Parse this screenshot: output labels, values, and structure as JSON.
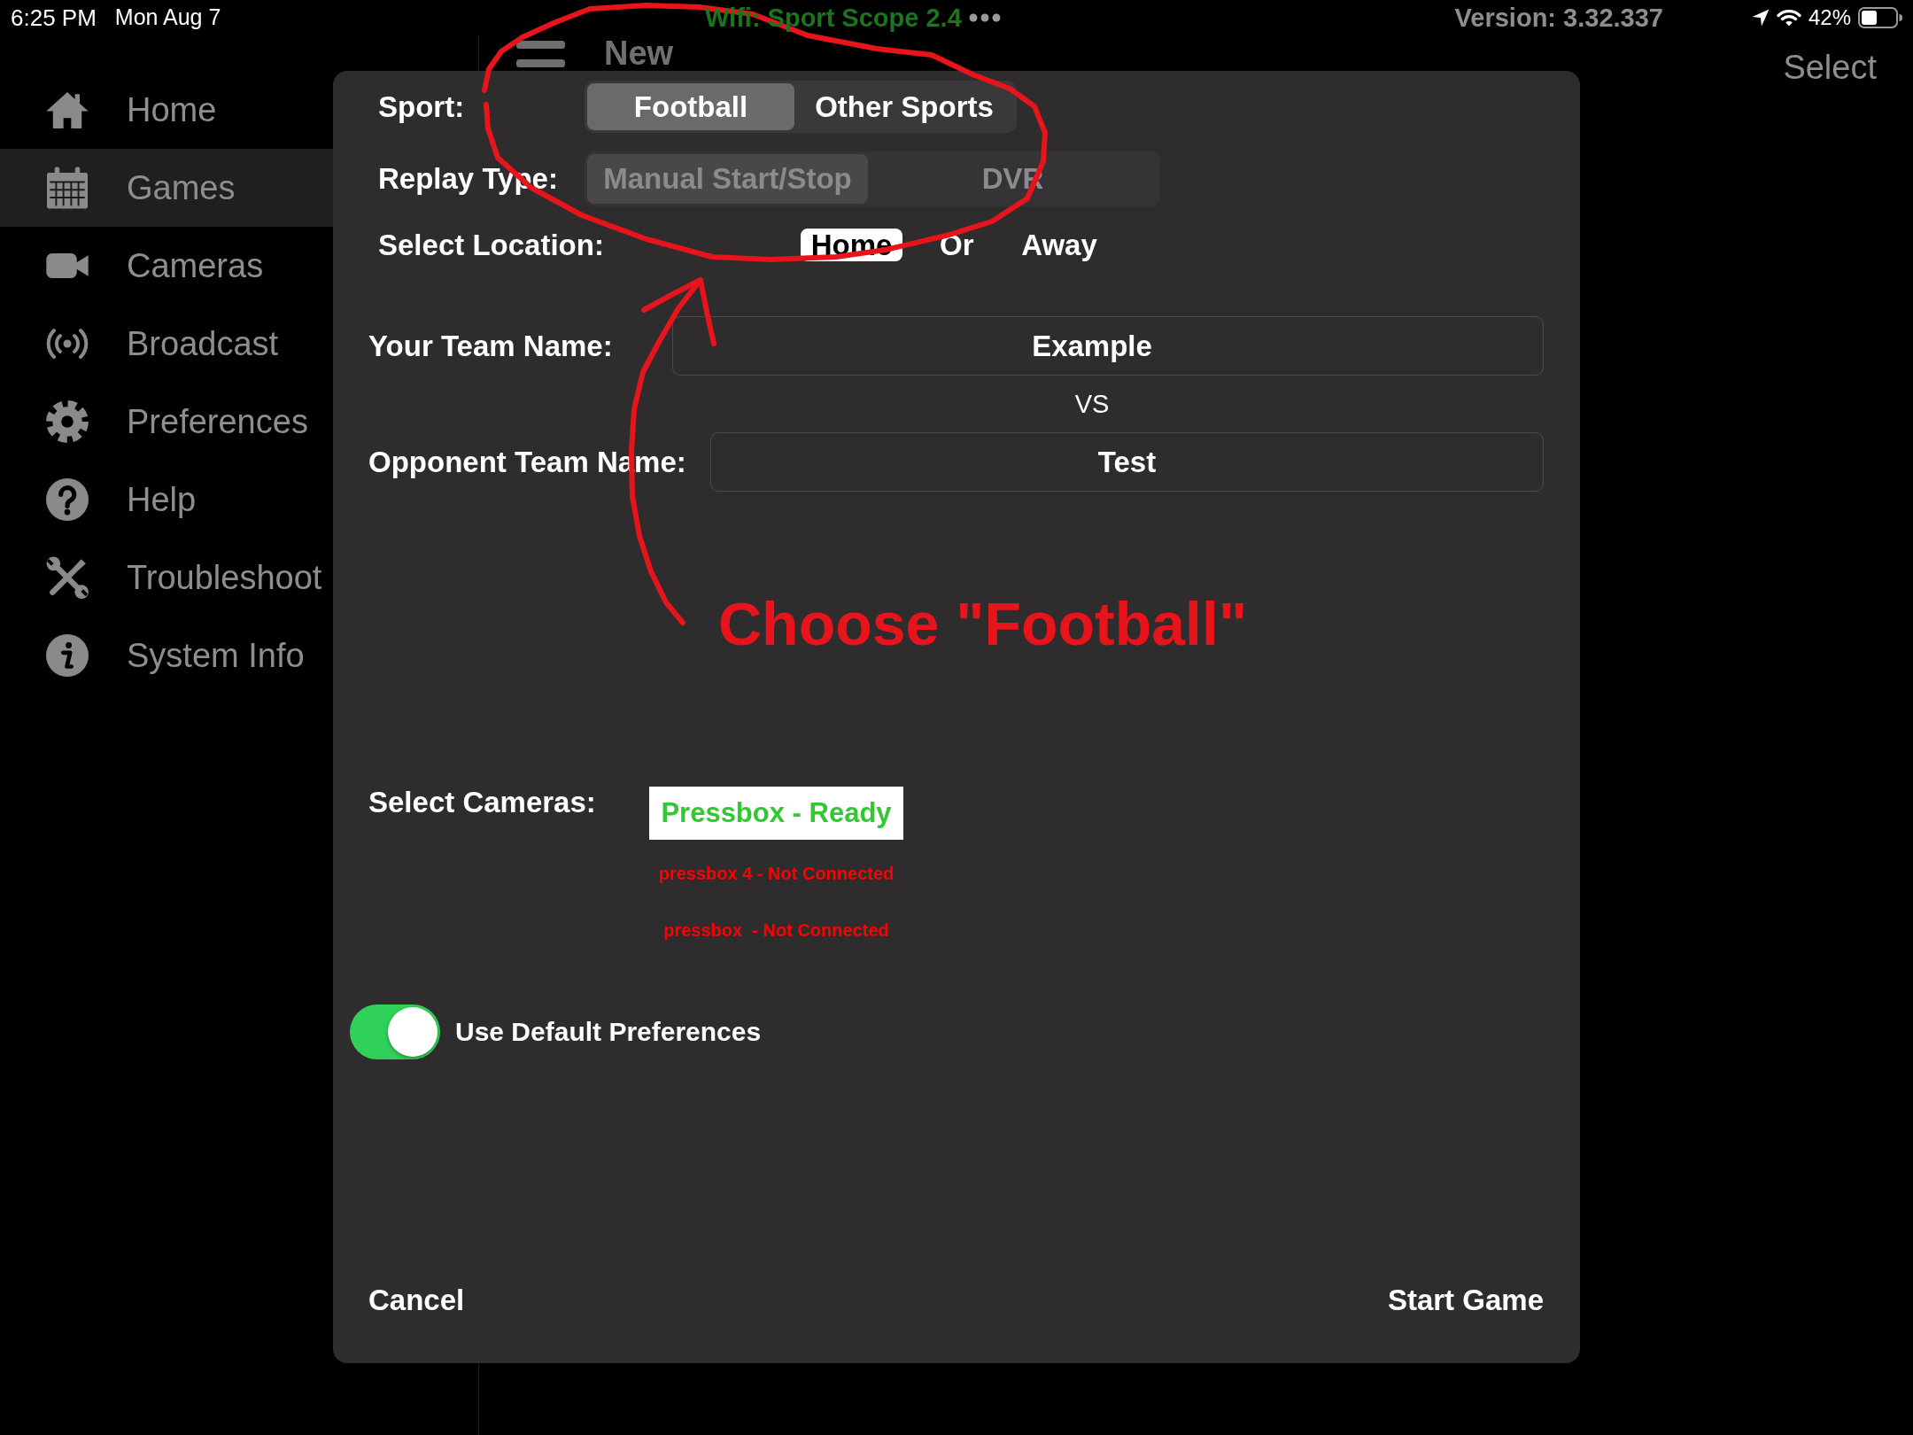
{
  "status_bar": {
    "time": "6:25 PM",
    "date": "Mon Aug 7",
    "app_status": "Wifi: Sport Scope 2.4",
    "version": "Version: 3.32.337",
    "battery": "42%"
  },
  "nav_bar": {
    "title": "New",
    "action": "Select"
  },
  "sidebar": {
    "items": [
      {
        "label": "Home",
        "selected": false
      },
      {
        "label": "Games",
        "selected": true
      },
      {
        "label": "Cameras",
        "selected": false
      },
      {
        "label": "Broadcast",
        "selected": false
      },
      {
        "label": "Preferences",
        "selected": false
      },
      {
        "label": "Help",
        "selected": false
      },
      {
        "label": "Troubleshoot",
        "selected": false
      },
      {
        "label": "System Info",
        "selected": false
      }
    ]
  },
  "dialog": {
    "sport": {
      "label": "Sport:",
      "options": [
        {
          "label": "Football",
          "selected": true
        },
        {
          "label": "Other Sports",
          "selected": false
        }
      ]
    },
    "replay_type": {
      "label": "Replay Type:",
      "disabled": true,
      "options": [
        {
          "label": "Manual Start/Stop",
          "selected": true
        },
        {
          "label": "DVR",
          "selected": false
        }
      ]
    },
    "location": {
      "label": "Select Location:",
      "separator": "Or",
      "options": [
        {
          "label": "Home",
          "selected": true
        },
        {
          "label": "Away",
          "selected": false
        }
      ]
    },
    "team_name": {
      "label": "Your Team Name:",
      "value": "Example"
    },
    "versus": "VS",
    "opponent_name": {
      "label": "Opponent Team Name:",
      "value": "Test"
    },
    "cameras": {
      "label": "Select Cameras:",
      "items": [
        {
          "name": "Pressbox - Ready",
          "selected": true,
          "color": "#33c833"
        },
        {
          "name": "pressbox 4 - Not Connected",
          "selected": false,
          "color": "#ff0000"
        },
        {
          "name": "pressbox  - Not Connected",
          "selected": false,
          "color": "#ff0000"
        }
      ]
    },
    "default_preferences": {
      "label": "Use Default Preferences",
      "on": true
    },
    "buttons": [
      {
        "label": "Cancel"
      },
      {
        "label": "Start Game"
      }
    ]
  },
  "annotation": {
    "text": "Choose \"Football\""
  }
}
